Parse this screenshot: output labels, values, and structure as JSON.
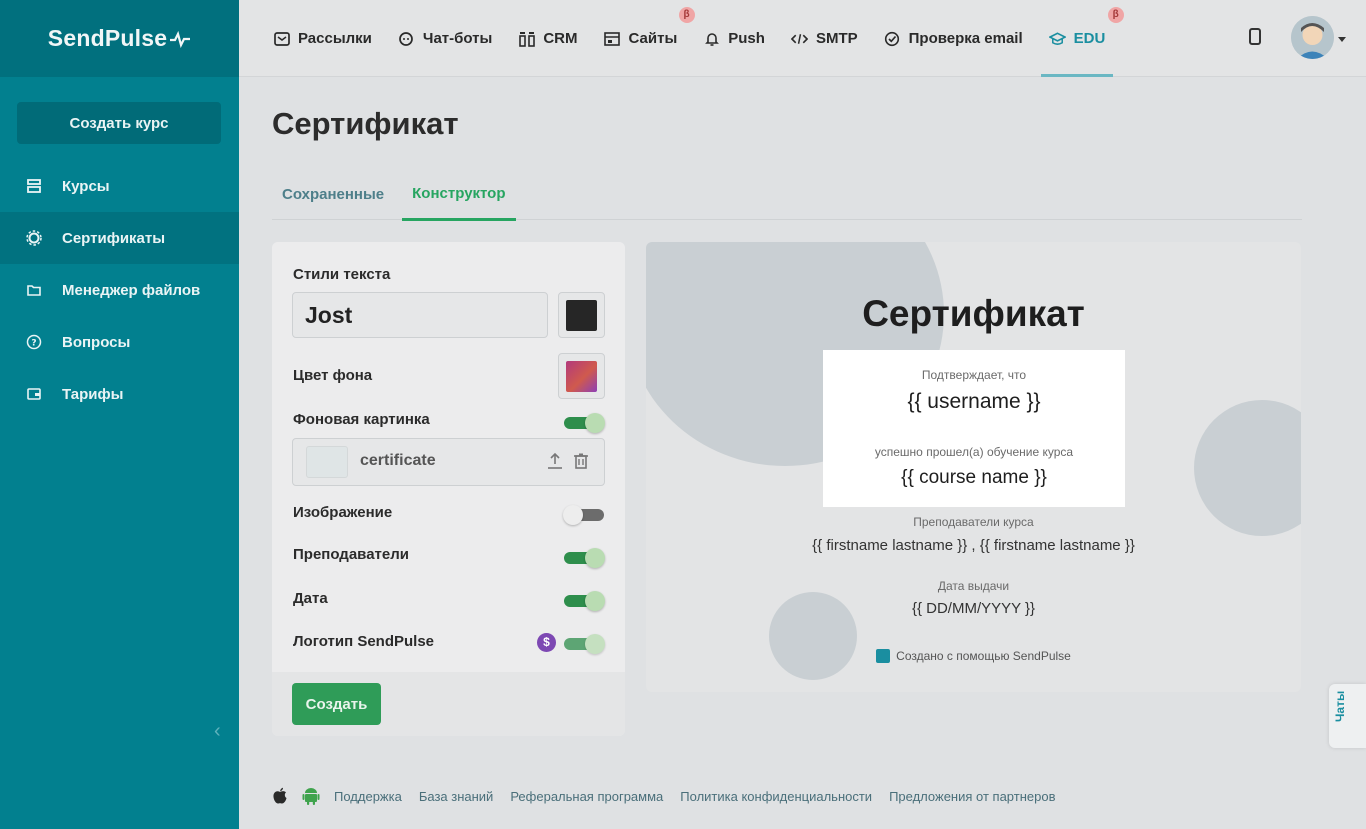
{
  "app": {
    "logo": "SendPulse"
  },
  "sidebar": {
    "create_label": "Создать курс",
    "items": [
      {
        "label": "Курсы",
        "icon": "courses-icon"
      },
      {
        "label": "Сертификаты",
        "icon": "certificate-icon"
      },
      {
        "label": "Менеджер файлов",
        "icon": "folder-icon"
      },
      {
        "label": "Вопросы",
        "icon": "question-icon"
      },
      {
        "label": "Тарифы",
        "icon": "wallet-icon"
      }
    ],
    "active_index": 1
  },
  "topnav": {
    "items": [
      {
        "label": "Рассылки",
        "icon": "mail-icon"
      },
      {
        "label": "Чат-боты",
        "icon": "chat-icon"
      },
      {
        "label": "CRM",
        "icon": "crm-icon"
      },
      {
        "label": "Сайты",
        "icon": "site-icon",
        "beta": "β"
      },
      {
        "label": "Push",
        "icon": "bell-icon"
      },
      {
        "label": "SMTP",
        "icon": "code-icon"
      },
      {
        "label": "Проверка email",
        "icon": "check-circle-icon"
      },
      {
        "label": "EDU",
        "icon": "graduation-cap-icon",
        "beta": "β"
      }
    ],
    "active_index": 7
  },
  "page": {
    "title": "Сертификат",
    "tabs": [
      "Сохраненные",
      "Конструктор"
    ],
    "active_tab": 1
  },
  "settings": {
    "text_styles_label": "Стили текста",
    "font_value": "Jost",
    "text_color": "#2b2b2b",
    "bg_color_label": "Цвет фона",
    "bg_image_label": "Фоновая картинка",
    "bg_image_on": true,
    "bg_image_name": "certificate",
    "image_label": "Изображение",
    "image_on": false,
    "teachers_label": "Преподаватели",
    "teachers_on": true,
    "date_label": "Дата",
    "date_on": true,
    "logo_label": "Логотип SendPulse",
    "logo_on": true,
    "paid_badge": "$",
    "create_label": "Создать"
  },
  "preview": {
    "title": "Сертификат",
    "confirms": "Подтверждает, что",
    "username": "{{ username }}",
    "completed": "успешно прошел(а) обучение курса",
    "course": "{{ course name }}",
    "teachers_label": "Преподаватели курса",
    "teachers": "{{ firstname lastname }} , {{ firstname lastname }}",
    "date_label": "Дата выдачи",
    "date": "{{ DD/MM/YYYY }}",
    "made_with": "Создано с помощью SendPulse"
  },
  "footer": {
    "links": [
      "Поддержка",
      "База знаний",
      "Реферальная программа",
      "Политика конфиденциальности",
      "Предложения от партнеров"
    ]
  },
  "chat_tab": "Чаты",
  "colors": {
    "brand": "#02808f",
    "accent_green": "#2f9c58",
    "active_tab": "#27a561"
  }
}
